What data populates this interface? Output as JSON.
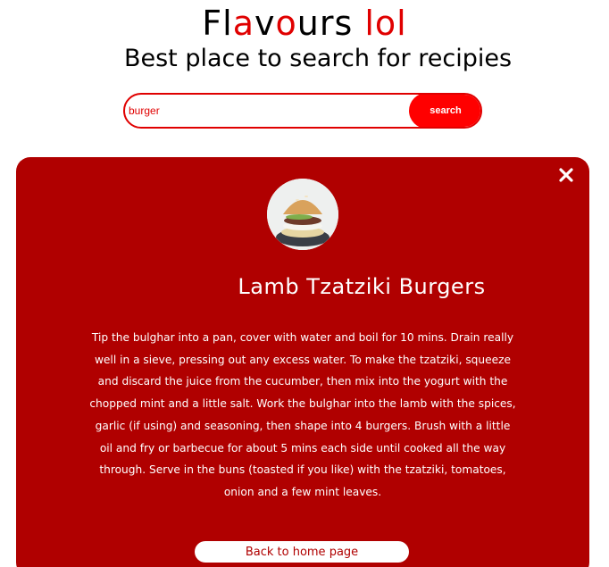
{
  "header": {
    "brand_prefix": "Fl",
    "brand_red_1": "a",
    "brand_mid_1": "v",
    "brand_red_2": "o",
    "brand_mid_2": "urs ",
    "brand_red_3": "lol",
    "tagline": "Best place to search for recipies"
  },
  "search": {
    "value": "burger",
    "button_label": "search"
  },
  "recipe": {
    "title": "Lamb Tzatziki Burgers",
    "instructions": "Tip the bulghar into a pan, cover with water and boil for 10 mins. Drain really well in a sieve, pressing out any excess water. To make the tzatziki, squeeze and discard the juice from the cucumber, then mix into the yogurt with the chopped mint and a little salt. Work the bulghar into the lamb with the spices, garlic (if using) and seasoning, then shape into 4 burgers. Brush with a little oil and fry or barbecue for about 5 mins each side until cooked all the way through. Serve in the buns (toasted if you like) with the tzatziki, tomatoes, onion and a few mint leaves.",
    "back_label": "Back to home page"
  },
  "colors": {
    "accent": "#e00000",
    "modal_background": "#b00000",
    "button": "#ff0000"
  },
  "icons": {
    "close": "close-icon",
    "recipe_image": "burger-photo"
  }
}
